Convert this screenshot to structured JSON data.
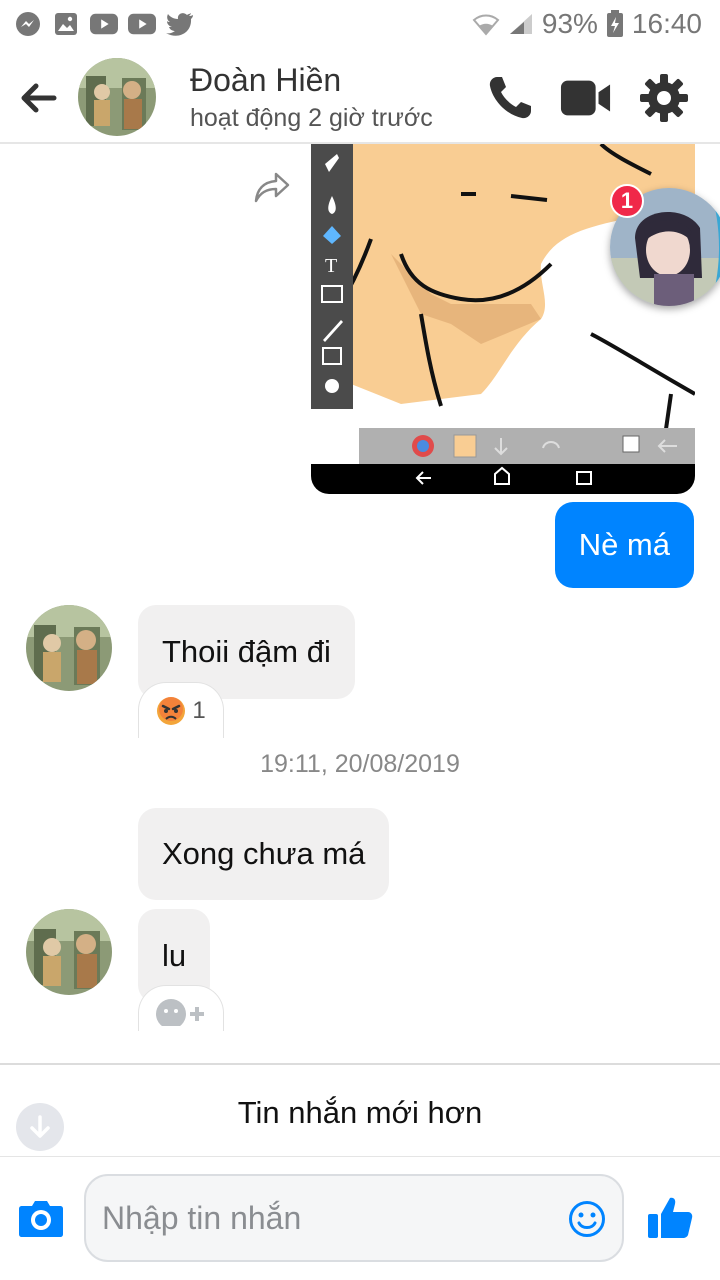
{
  "status_bar": {
    "battery": "93%",
    "time": "16:40",
    "left_icons": [
      "messenger-icon",
      "gallery-icon",
      "youtube-icon",
      "youtube-icon",
      "twitter-icon"
    ]
  },
  "header": {
    "name": "Đoàn Hiền",
    "status": "hoạt động 2 giờ trước"
  },
  "messages": {
    "sent_text": "Nè má",
    "received_1": "Thoii đậm đi",
    "reaction_count": "1",
    "timestamp": "19:11, 20/08/2019",
    "received_2": "Xong chưa má",
    "received_3": "lu"
  },
  "chat_head": {
    "badge": "1"
  },
  "new_messages_bar": {
    "label": "Tin nhắn mới hơn"
  },
  "composer": {
    "placeholder": "Nhập tin nhắn",
    "value": ""
  },
  "colors": {
    "accent": "#0084ff",
    "incoming_bubble": "#f1f0f0",
    "badge": "#f02849"
  }
}
